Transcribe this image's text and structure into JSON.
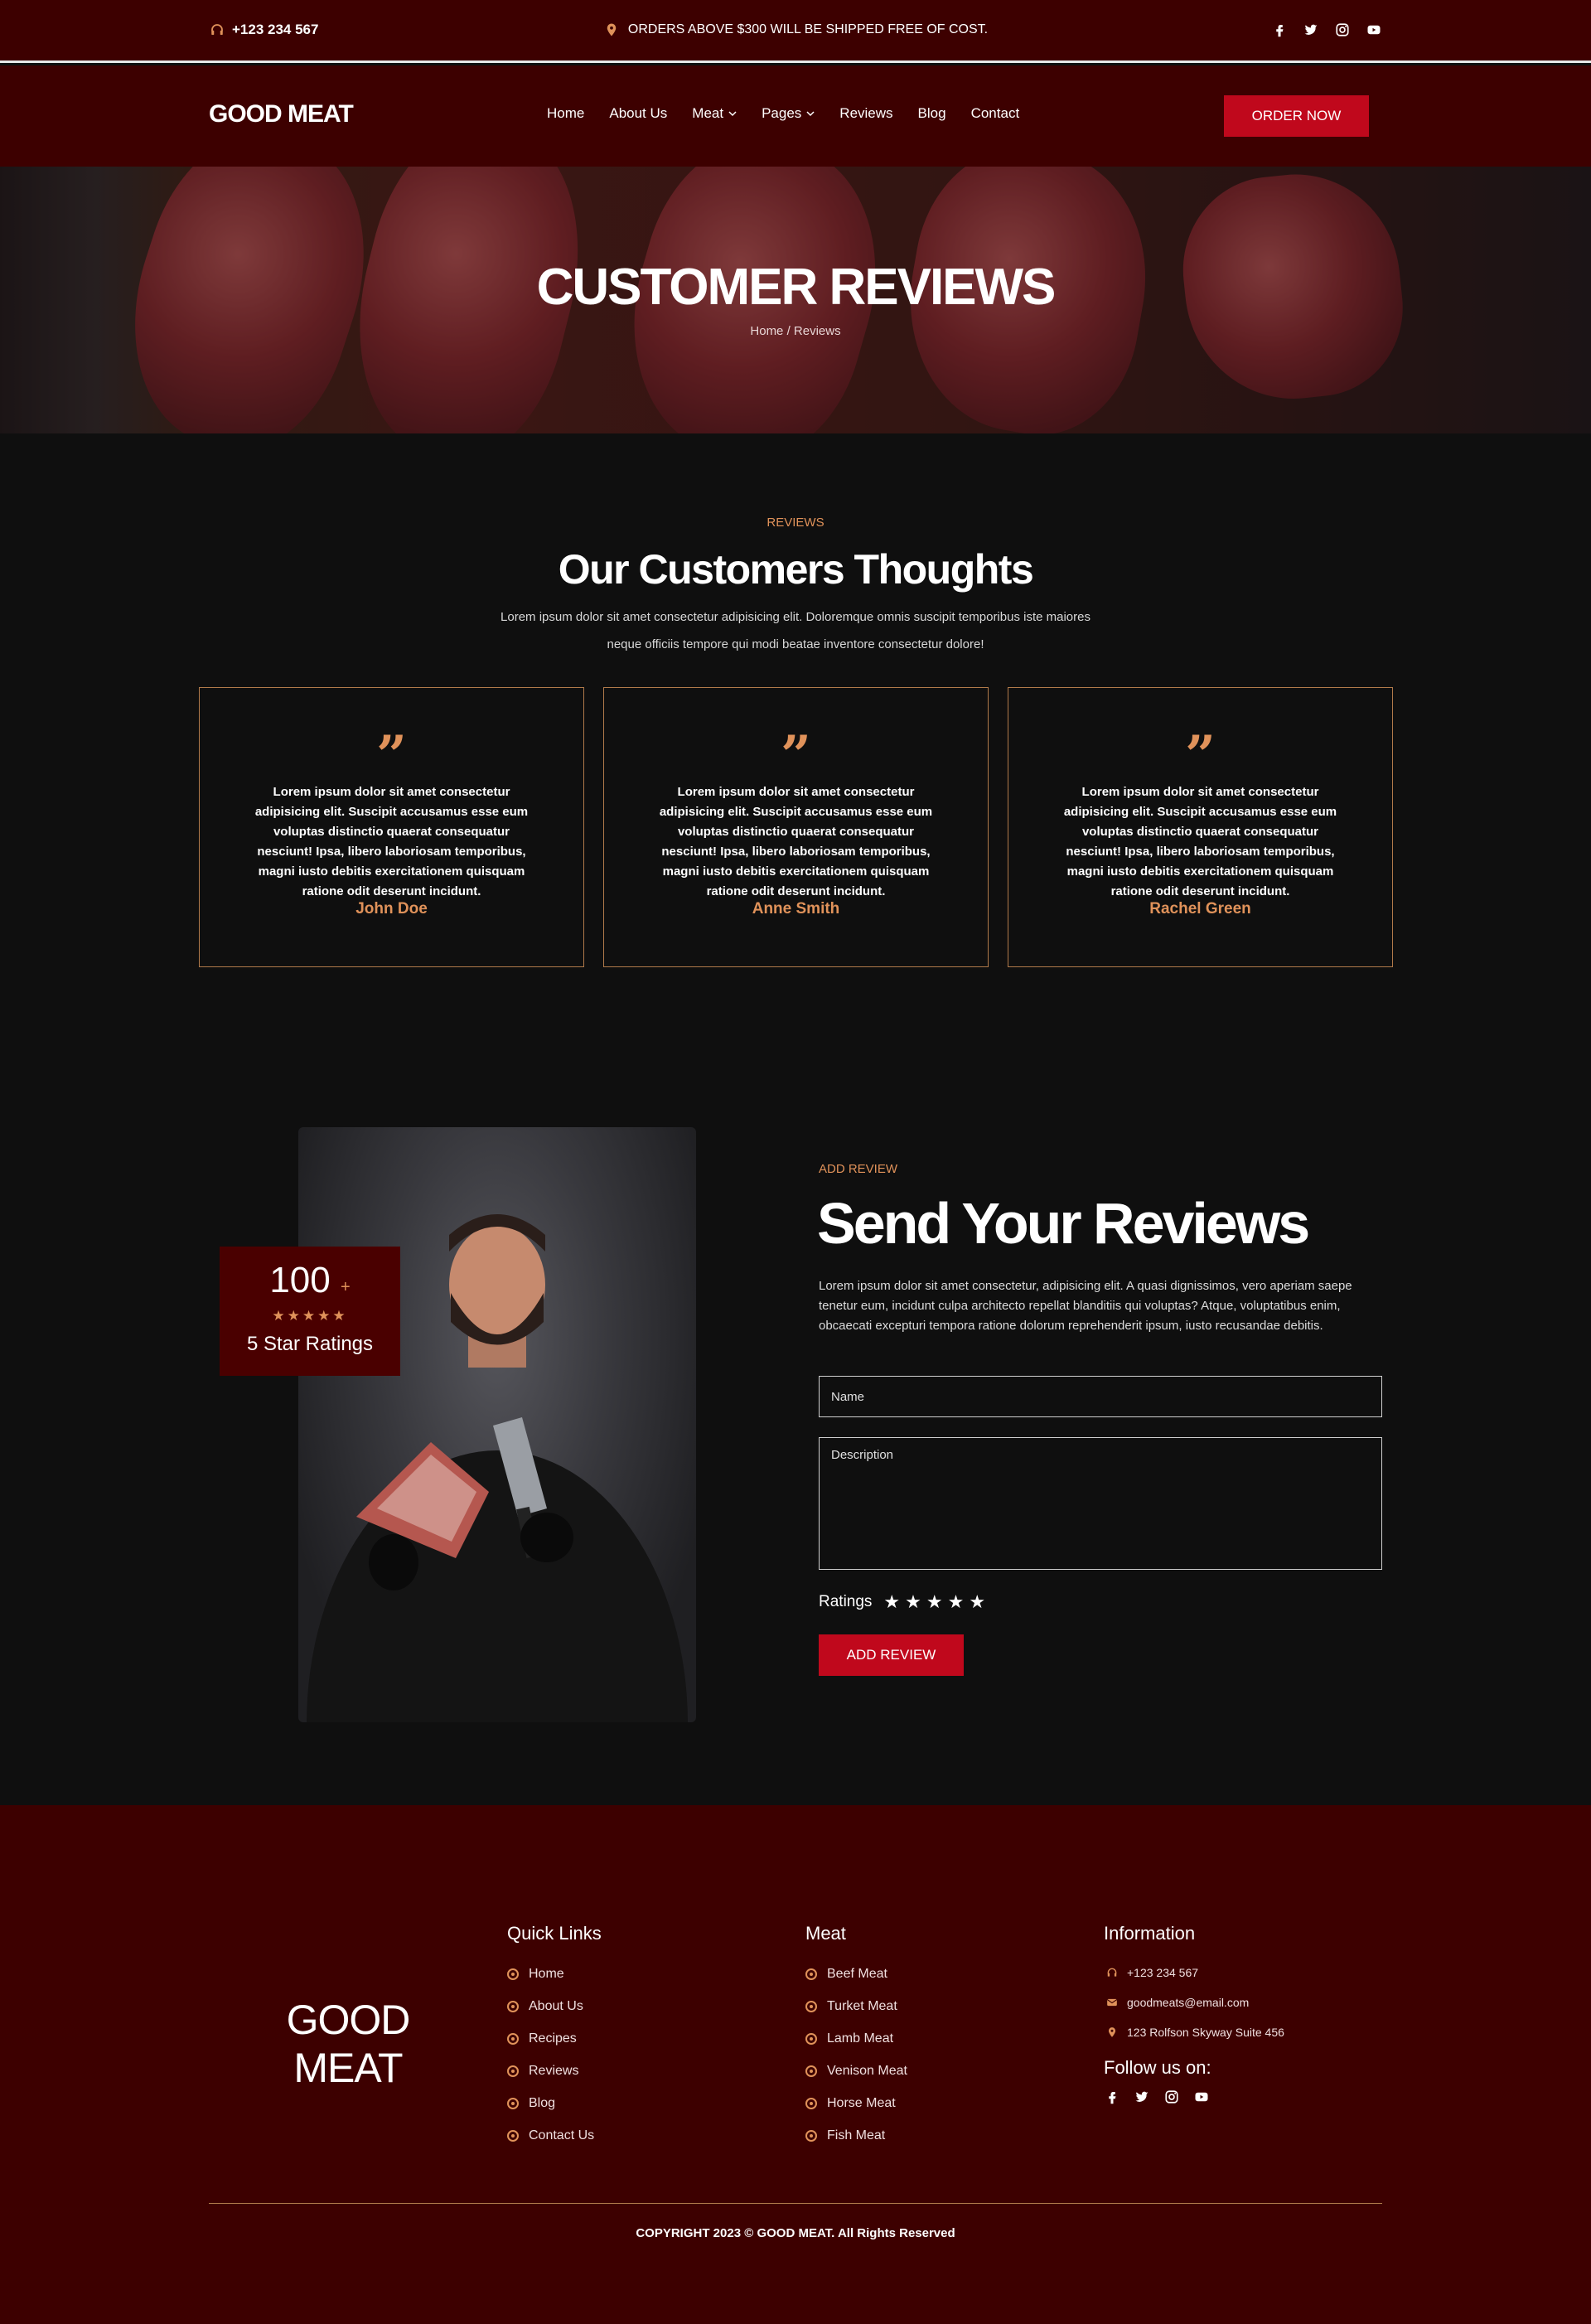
{
  "topbar": {
    "phone": "+123 234 567",
    "notice": "ORDERS ABOVE $300 WILL BE SHIPPED FREE OF COST.",
    "social_icons": [
      "facebook-icon",
      "twitter-icon",
      "instagram-icon",
      "youtube-icon"
    ]
  },
  "nav": {
    "logo": "GOOD MEAT",
    "items": [
      "Home",
      "About Us",
      "Meat",
      "Pages",
      "Reviews",
      "Blog",
      "Contact"
    ],
    "order_button": "ORDER NOW"
  },
  "hero": {
    "title": "CUSTOMER REVIEWS",
    "breadcrumb": "Home / Reviews"
  },
  "reviews": {
    "tag": "REVIEWS",
    "title": "Our Customers Thoughts",
    "subtitle": "Lorem ipsum dolor sit amet consectetur adipisicing elit. Doloremque omnis suscipit temporibus iste maiores neque officiis tempore qui modi beatae inventore consectetur dolore!",
    "cards": [
      {
        "text": "Lorem ipsum dolor sit amet consectetur adipisicing elit. Suscipit accusamus esse eum voluptas distinctio quaerat consequatur nesciunt! Ipsa, libero laboriosam temporibus, magni iusto debitis exercitationem quisquam ratione odit deserunt incidunt.",
        "name": "John Doe"
      },
      {
        "text": "Lorem ipsum dolor sit amet consectetur adipisicing elit. Suscipit accusamus esse eum voluptas distinctio quaerat consequatur nesciunt! Ipsa, libero laboriosam temporibus, magni iusto debitis exercitationem quisquam ratione odit deserunt incidunt.",
        "name": "Anne Smith"
      },
      {
        "text": "Lorem ipsum dolor sit amet consectetur adipisicing elit. Suscipit accusamus esse eum voluptas distinctio quaerat consequatur nesciunt! Ipsa, libero laboriosam temporibus, magni iusto debitis exercitationem quisquam ratione odit deserunt incidunt.",
        "name": "Rachel Green"
      }
    ]
  },
  "badge": {
    "number": "100",
    "plus": "+",
    "stars": "★★★★★",
    "label": "5 Star Ratings"
  },
  "add_review": {
    "tag": "ADD REVIEW",
    "title": "Send Your Reviews",
    "text": "Lorem ipsum dolor sit amet consectetur, adipisicing elit. A quasi dignissimos, vero aperiam saepe tenetur eum, incidunt culpa architecto repellat blanditiis qui voluptas? Atque, voluptatibus enim, obcaecati excepturi tempora ratione dolorum reprehenderit ipsum, iusto recusandae debitis.",
    "name_placeholder": "Name",
    "description_placeholder": "Description",
    "ratings_label": "Ratings",
    "button": "ADD REVIEW"
  },
  "footer": {
    "logo_line1": "GOOD",
    "logo_line2": "MEAT",
    "quick_links_title": "Quick Links",
    "quick_links": [
      "Home",
      "About Us",
      "Recipes",
      "Reviews",
      "Blog",
      "Contact Us"
    ],
    "meat_title": "Meat",
    "meat_links": [
      "Beef Meat",
      "Turket Meat",
      "Lamb Meat",
      "Venison Meat",
      "Horse Meat",
      "Fish Meat"
    ],
    "info_title": "Information",
    "phone": "+123 234 567",
    "email": "goodmeats@email.com",
    "address": "123 Rolfson Skyway Suite 456",
    "follow": "Follow us on:",
    "copyright": "COPYRIGHT 2023 © GOOD MEAT. All Rights Reserved"
  },
  "colors": {
    "maroon": "#3d0000",
    "accent": "#e0925a",
    "button": "#c0081c",
    "dark": "#0f0f0f"
  }
}
